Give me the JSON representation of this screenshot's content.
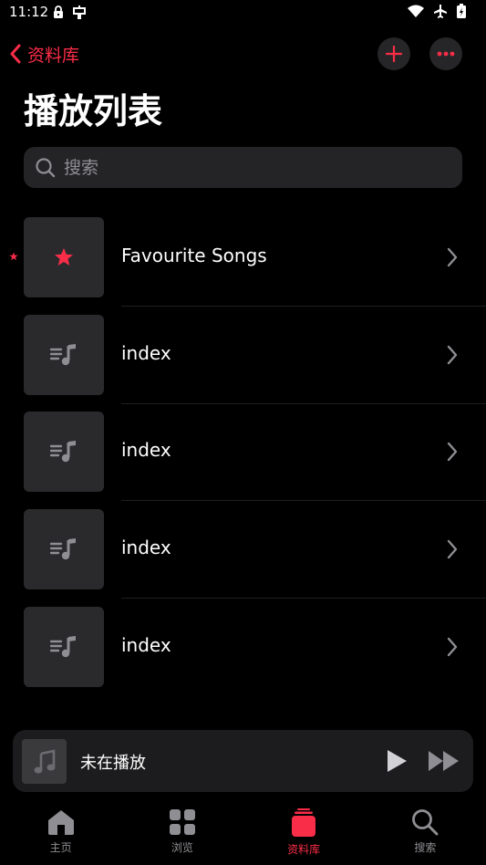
{
  "status_bar": {
    "time": "11:12"
  },
  "header": {
    "back_label": "资料库",
    "title": "播放列表"
  },
  "search": {
    "placeholder": "搜索"
  },
  "playlists": [
    {
      "name": "Favourite Songs",
      "kind": "favourites"
    },
    {
      "name": "index",
      "kind": "playlist"
    },
    {
      "name": "index",
      "kind": "playlist"
    },
    {
      "name": "index",
      "kind": "playlist"
    },
    {
      "name": "index",
      "kind": "playlist"
    }
  ],
  "mini_player": {
    "title": "未在播放"
  },
  "tabs": [
    {
      "label": "主页",
      "icon": "home-icon",
      "active": false
    },
    {
      "label": "浏览",
      "icon": "grid-icon",
      "active": false
    },
    {
      "label": "资料库",
      "icon": "library-icon",
      "active": true
    },
    {
      "label": "搜索",
      "icon": "search-icon",
      "active": false
    }
  ],
  "colors": {
    "accent": "#fa2d48",
    "background": "#000000",
    "thumb": "#2a2a2c"
  }
}
